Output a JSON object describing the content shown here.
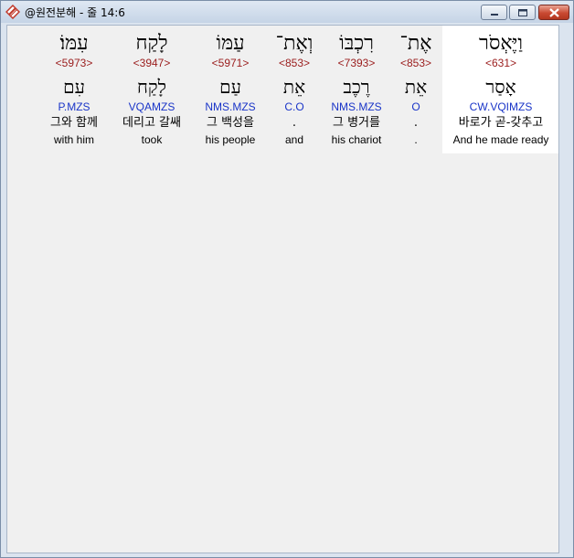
{
  "window": {
    "title": "@원전분해 - 줄 14:6",
    "accent": "#dbe4ef",
    "close_color": "#c94a32"
  },
  "words": [
    {
      "hebrew": "וַיֶּאְסֹר",
      "strong": "<631>",
      "lemma": "אָסַר",
      "morph": "CW.VQIMZS",
      "korean": "바로가 곧-갖추고",
      "english": "And he made ready"
    },
    {
      "hebrew": "אֶת־",
      "strong": "<853>",
      "lemma": "אֵת",
      "morph": "O",
      "korean": ".",
      "english": "."
    },
    {
      "hebrew": "רִכְבּוֹ",
      "strong": "<7393>",
      "lemma": "רֶכֶב",
      "morph": "NMS.MZS",
      "korean": "그 병거를",
      "english": "his chariot"
    },
    {
      "hebrew": "וְאֶת־",
      "strong": "<853>",
      "lemma": "אֵת",
      "morph": "C.O",
      "korean": ".",
      "english": "and"
    },
    {
      "hebrew": "עַמּוֹ",
      "strong": "<5971>",
      "lemma": "עַם",
      "morph": "NMS.MZS",
      "korean": "그 백성을",
      "english": "his people"
    },
    {
      "hebrew": "לָקַח",
      "strong": "<3947>",
      "lemma": "לָקַח",
      "morph": "VQAMZS",
      "korean": "데리고 갈쌔",
      "english": "took"
    },
    {
      "hebrew": "עִמּוֹ׃",
      "strong": "<5973>",
      "lemma": "עִם",
      "morph": "P.MZS",
      "korean": "그와 함께",
      "english": "with him"
    }
  ]
}
